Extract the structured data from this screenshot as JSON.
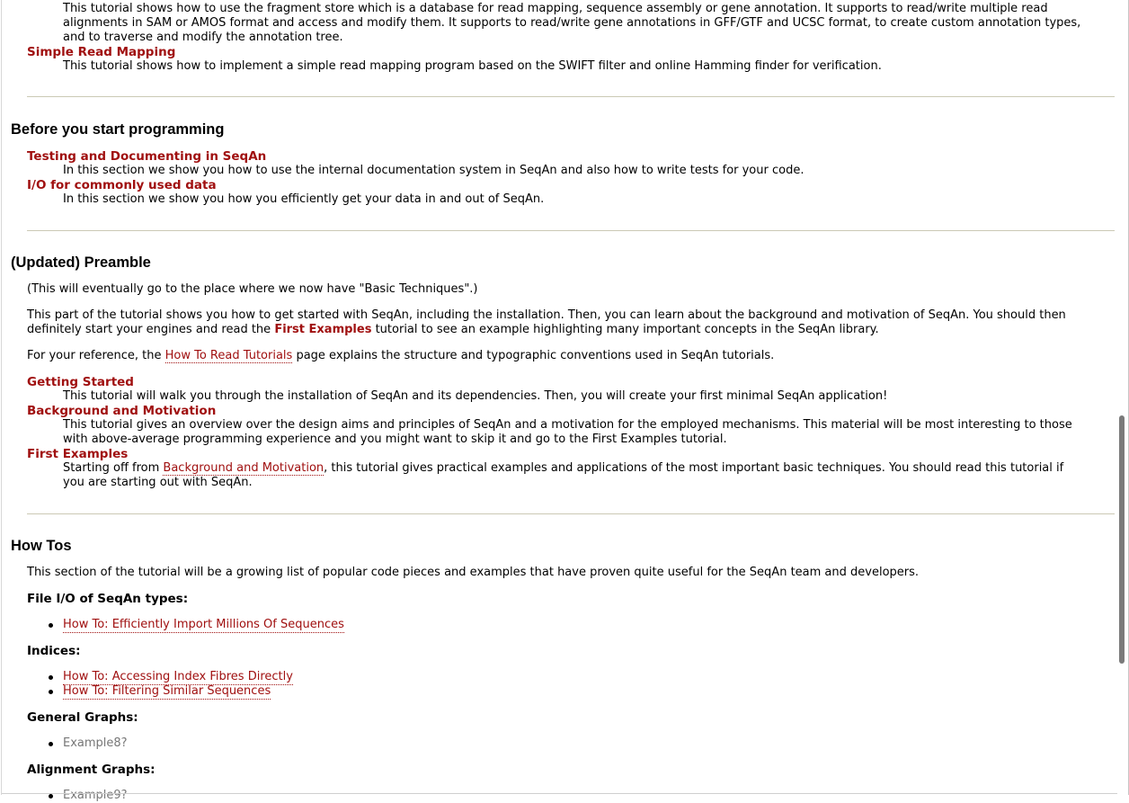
{
  "top": {
    "fragment_desc_lines": [
      "This tutorial shows how to use the fragment store which is a database for read mapping, sequence assembly or gene annotation. It supports to read/write multiple read",
      "alignments in SAM or AMOS format and access and modify them. It supports to read/write gene annotations in GFF/GTF and UCSC format, to create custom annotation types,",
      "and to traverse and modify the annotation tree."
    ],
    "simple_read_mapping": {
      "title": "Simple Read Mapping",
      "desc": "This tutorial shows how to implement a simple read mapping program based on the SWIFT filter and online Hamming finder for verification."
    }
  },
  "before": {
    "heading": "Before you start programming",
    "items": [
      {
        "title": "Testing and Documenting in SeqAn",
        "desc": "In this section we show you how to use the internal documentation system in SeqAn and also how to write tests for your code."
      },
      {
        "title": "I/O for commonly used data",
        "desc": "In this section we show you how you efficiently get your data in and out of SeqAn."
      }
    ]
  },
  "preamble": {
    "heading": "(Updated) Preamble",
    "note": "(This will eventually go to the place where we now have \"Basic Techniques\".)",
    "para1_line1": "This part of the tutorial shows you how to get started with SeqAn, including the installation. Then, you can learn about the background and motivation of SeqAn. You should then",
    "para1_pre": "definitely start your engines and read the ",
    "para1_link": "First Examples",
    "para1_post": " tutorial to see an example highlighting many important concepts in the SeqAn library.",
    "para2_pre": "For your reference, the ",
    "para2_link": "How To Read Tutorials",
    "para2_post": " page explains the structure and typographic conventions used in SeqAn tutorials.",
    "getting_started": {
      "title": "Getting Started",
      "desc": "This tutorial will walk you through the installation of SeqAn and its dependencies. Then, you will create your first minimal SeqAn application!"
    },
    "background": {
      "title": "Background and Motivation",
      "desc_line1": "This tutorial gives an overview over the design aims and principles of SeqAn and a motivation for the employed mechanisms. This material will be most interesting to those",
      "desc_line2": "with above-average programming experience and you might want to skip it and go to the First Examples tutorial."
    },
    "first_examples": {
      "title": "First Examples",
      "desc_pre": "Starting off from ",
      "desc_link": "Background and Motivation",
      "desc_post": ", this tutorial gives practical examples and applications of the most important basic techniques. You should read this tutorial if",
      "desc_line2": "you are starting out with SeqAn."
    }
  },
  "howtos": {
    "heading": "How Tos",
    "intro": "This section of the tutorial will be a growing list of popular code pieces and examples that have proven quite useful for the SeqAn team and developers.",
    "file_io": {
      "label": "File I/O of SeqAn types:",
      "items": [
        "How To: Efficiently Import Millions Of Sequences"
      ]
    },
    "indices": {
      "label": "Indices:",
      "items": [
        "How To: Accessing Index Fibres Directly",
        "How To: Filtering Similar Sequences"
      ]
    },
    "general_graphs": {
      "label": "General Graphs:",
      "items": [
        "Example8?"
      ]
    },
    "alignment_graphs": {
      "label": "Alignment Graphs:",
      "items": [
        "Example9?"
      ]
    }
  },
  "colors": {
    "link": "#a01010",
    "rule": "#cbc9b5",
    "missing_link": "#777777"
  }
}
